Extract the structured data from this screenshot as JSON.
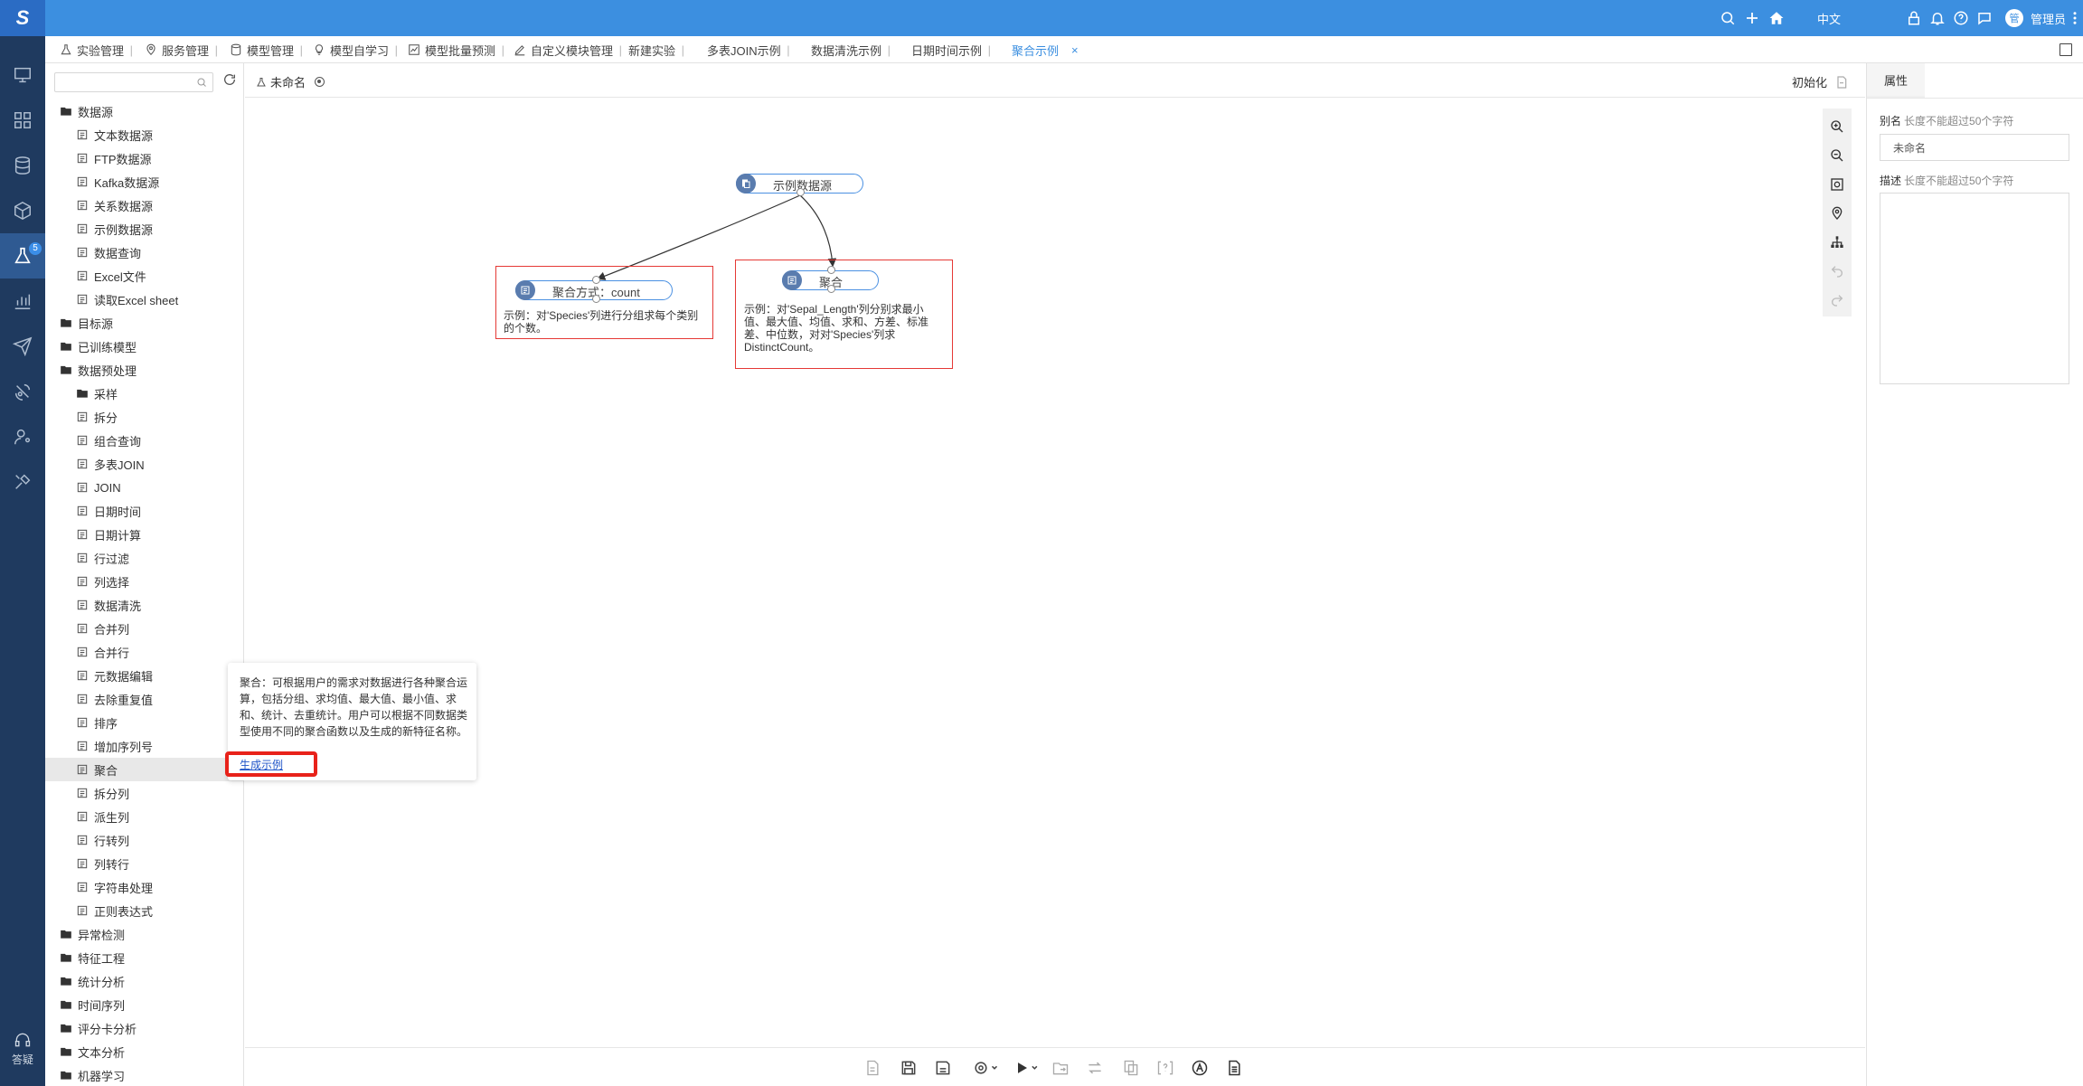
{
  "logo": {
    "letter": "S"
  },
  "rail": {
    "badge": "5",
    "qa_label": "答疑"
  },
  "topbar": {
    "lang": "中文",
    "avatar": "管",
    "user": "管理员"
  },
  "tabs": [
    {
      "label": "实验管理",
      "icon": "flask-icon"
    },
    {
      "label": "服务管理",
      "icon": "location-pin-icon"
    },
    {
      "label": "模型管理",
      "icon": "database-icon"
    },
    {
      "label": "模型自学习",
      "icon": "bulb-icon"
    },
    {
      "label": "模型批量预测",
      "icon": "chart-icon"
    },
    {
      "label": "自定义模块管理",
      "icon": "pen-icon"
    },
    {
      "label": "新建实验",
      "icon": ""
    },
    {
      "label": "多表JOIN示例",
      "icon": ""
    },
    {
      "label": "数据清洗示例",
      "icon": ""
    },
    {
      "label": "日期时间示例",
      "icon": ""
    },
    {
      "label": "聚合示例",
      "icon": "",
      "active": true,
      "close": "×"
    }
  ],
  "tree": {
    "search_placeholder": "",
    "nodes": [
      {
        "label": "数据源",
        "type": "folder",
        "level": 0
      },
      {
        "label": "文本数据源",
        "type": "leaf",
        "level": 1
      },
      {
        "label": "FTP数据源",
        "type": "leaf",
        "level": 1
      },
      {
        "label": "Kafka数据源",
        "type": "leaf",
        "level": 1
      },
      {
        "label": "关系数据源",
        "type": "leaf",
        "level": 1
      },
      {
        "label": "示例数据源",
        "type": "leaf",
        "level": 1
      },
      {
        "label": "数据查询",
        "type": "leaf",
        "level": 1
      },
      {
        "label": "Excel文件",
        "type": "leaf",
        "level": 1
      },
      {
        "label": "读取Excel sheet",
        "type": "leaf",
        "level": 1
      },
      {
        "label": "目标源",
        "type": "folder",
        "level": 0
      },
      {
        "label": "已训练模型",
        "type": "folder",
        "level": 0
      },
      {
        "label": "数据预处理",
        "type": "folder",
        "level": 0
      },
      {
        "label": "采样",
        "type": "folder",
        "level": 1
      },
      {
        "label": "拆分",
        "type": "leaf",
        "level": 1
      },
      {
        "label": "组合查询",
        "type": "leaf",
        "level": 1
      },
      {
        "label": "多表JOIN",
        "type": "leaf",
        "level": 1
      },
      {
        "label": "JOIN",
        "type": "leaf",
        "level": 1
      },
      {
        "label": "日期时间",
        "type": "leaf",
        "level": 1
      },
      {
        "label": "日期计算",
        "type": "leaf",
        "level": 1
      },
      {
        "label": "行过滤",
        "type": "leaf",
        "level": 1
      },
      {
        "label": "列选择",
        "type": "leaf",
        "level": 1
      },
      {
        "label": "数据清洗",
        "type": "leaf",
        "level": 1
      },
      {
        "label": "合并列",
        "type": "leaf",
        "level": 1
      },
      {
        "label": "合并行",
        "type": "leaf",
        "level": 1
      },
      {
        "label": "元数据编辑",
        "type": "leaf",
        "level": 1
      },
      {
        "label": "去除重复值",
        "type": "leaf",
        "level": 1
      },
      {
        "label": "排序",
        "type": "leaf",
        "level": 1
      },
      {
        "label": "增加序列号",
        "type": "leaf",
        "level": 1
      },
      {
        "label": "聚合",
        "type": "leaf",
        "level": 1,
        "selected": true
      },
      {
        "label": "拆分列",
        "type": "leaf",
        "level": 1
      },
      {
        "label": "派生列",
        "type": "leaf",
        "level": 1
      },
      {
        "label": "行转列",
        "type": "leaf",
        "level": 1
      },
      {
        "label": "列转行",
        "type": "leaf",
        "level": 1
      },
      {
        "label": "字符串处理",
        "type": "leaf",
        "level": 1
      },
      {
        "label": "正则表达式",
        "type": "leaf",
        "level": 1
      },
      {
        "label": "异常检测",
        "type": "folder",
        "level": 0
      },
      {
        "label": "特征工程",
        "type": "folder",
        "level": 0
      },
      {
        "label": "统计分析",
        "type": "folder",
        "level": 0
      },
      {
        "label": "时间序列",
        "type": "folder",
        "level": 0
      },
      {
        "label": "评分卡分析",
        "type": "folder",
        "level": 0
      },
      {
        "label": "文本分析",
        "type": "folder",
        "level": 0
      },
      {
        "label": "机器学习",
        "type": "folder",
        "level": 0
      }
    ]
  },
  "canvas": {
    "experiment_name": "未命名",
    "init_label": "初始化",
    "nodes": {
      "source": "示例数据源",
      "agg1": "聚合方式：count",
      "agg2": "聚合"
    },
    "desc1": "示例：对'Species'列进行分组求每个类别的个数。",
    "desc2": "示例：对'Sepal_Length'列分别求最小值、最大值、均值、求和、方差、标准差、中位数，对对'Species'列求DistinctCount。"
  },
  "tooltip": {
    "text": "聚合：可根据用户的需求对数据进行各种聚合运算，包括分组、求均值、最大值、最小值、求和、统计、去重统计。用户可以根据不同数据类型使用不同的聚合函数以及生成的新特征名称。",
    "link": "生成示例"
  },
  "props": {
    "tab": "属性",
    "alias_label": "别名",
    "alias_hint": "长度不能超过50个字符",
    "alias_value": "未命名",
    "desc_label": "描述",
    "desc_hint": "长度不能超过50个字符"
  }
}
